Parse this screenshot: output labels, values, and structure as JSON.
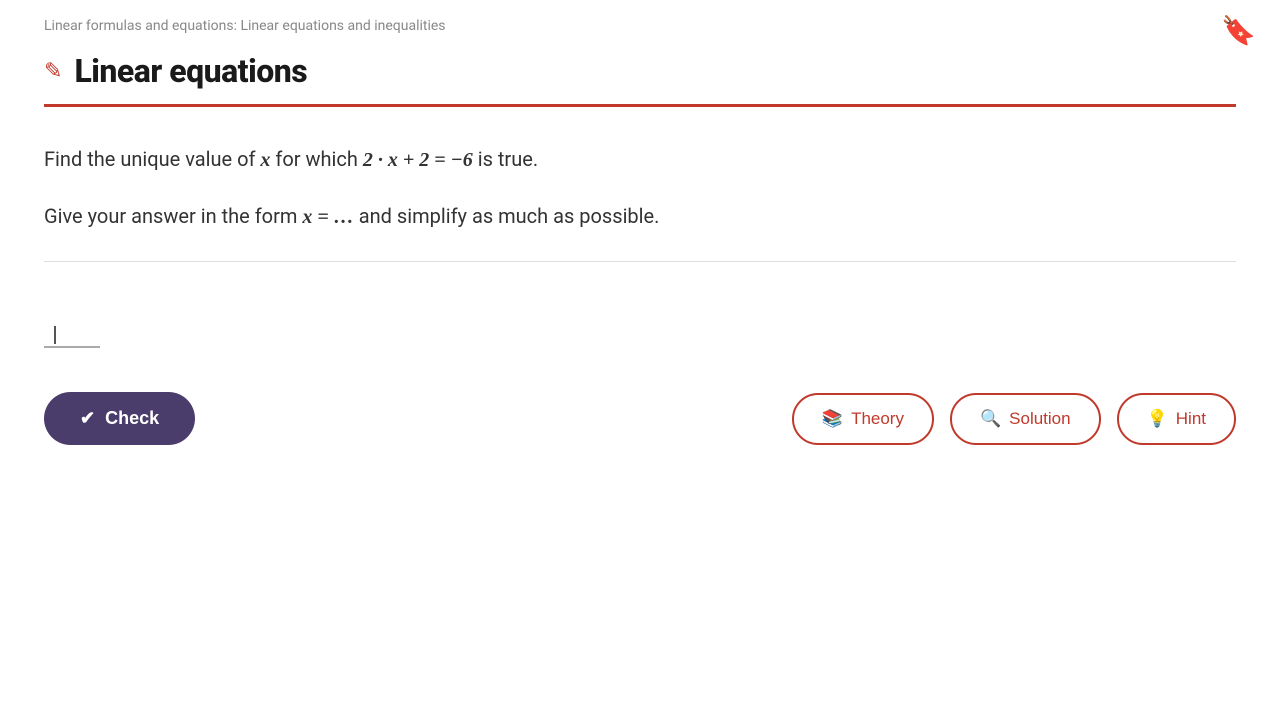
{
  "breadcrumb": {
    "text": "Linear formulas and equations: Linear equations and inequalities"
  },
  "page_title": "Linear equations",
  "pencil_icon": "✏",
  "bookmark_icon": "🔖",
  "problem": {
    "line1_prefix": "Find the unique value of ",
    "line1_var": "x",
    "line1_suffix": " for which ",
    "line1_equation": "2 · x + 2 = −6",
    "line1_end": " is true.",
    "line2_prefix": "Give your answer in the form ",
    "line2_form": "x = . . .",
    "line2_suffix": " and simplify as much as possible."
  },
  "buttons": {
    "check": "Check",
    "theory": "Theory",
    "solution": "Solution",
    "hint": "Hint"
  },
  "icons": {
    "check": "✔",
    "theory": "📖",
    "solution": "🔍",
    "hint": "💡"
  }
}
